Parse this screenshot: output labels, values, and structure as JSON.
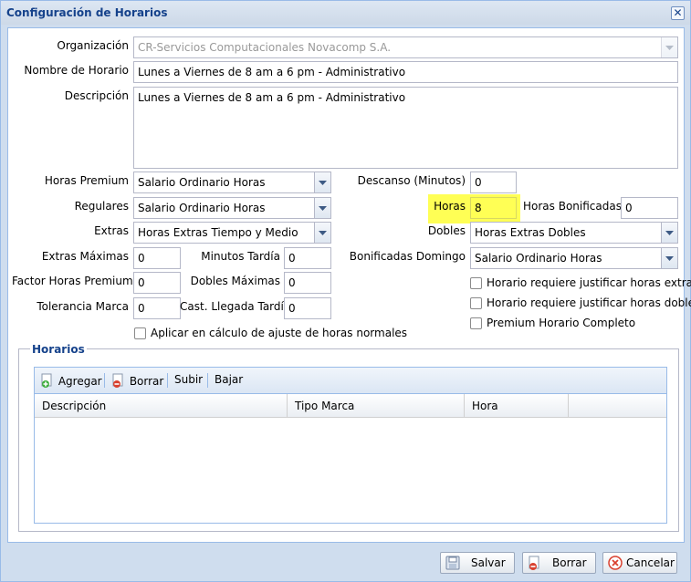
{
  "window": {
    "title": "Configuración de Horarios",
    "close_glyph": "✕"
  },
  "form": {
    "organizacion": {
      "label": "Organización",
      "value": "CR-Servicios Computacionales Novacomp S.A."
    },
    "nombre_horario": {
      "label": "Nombre de Horario",
      "value": "Lunes a Viernes de 8 am a 6 pm - Administrativo"
    },
    "descripcion": {
      "label": "Descripción",
      "value": "Lunes a Viernes de 8 am a 6 pm - Administrativo"
    },
    "horas_premium": {
      "label": "Horas Premium",
      "value": "Salario Ordinario Horas"
    },
    "regulares": {
      "label": "Regulares",
      "value": "Salario Ordinario Horas"
    },
    "extras": {
      "label": "Extras",
      "value": "Horas Extras Tiempo y Medio"
    },
    "extras_maximas": {
      "label": "Extras Máximas",
      "value": "0"
    },
    "minutos_tardia": {
      "label": "Minutos Tardía",
      "value": "0"
    },
    "factor_horas_premium": {
      "label": "Factor Horas Premium",
      "value": "0"
    },
    "dobles_maximas": {
      "label": "Dobles Máximas",
      "value": "0"
    },
    "tolerancia_marca": {
      "label": "Tolerancia Marca",
      "value": "0"
    },
    "cast_llegada_tardia": {
      "label": "Cast. Llegada Tardía",
      "value": "0"
    },
    "aplicar_calculo": {
      "label": "Aplicar en cálculo de ajuste de horas normales",
      "checked": false
    },
    "descanso": {
      "label": "Descanso (Minutos)",
      "value": "0"
    },
    "horas": {
      "label": "Horas",
      "value": "8"
    },
    "horas_bonificadas": {
      "label": "Horas Bonificadas",
      "value": "0"
    },
    "dobles": {
      "label": "Dobles",
      "value": "Horas Extras Dobles"
    },
    "bonificadas_domingo": {
      "label": "Bonificadas Domingo",
      "value": "Salario Ordinario Horas"
    },
    "justificar_extras": {
      "label": "Horario requiere justificar horas extras",
      "checked": false
    },
    "justificar_dobles": {
      "label": "Horario requiere justificar horas dobles",
      "checked": false
    },
    "premium_completo": {
      "label": "Premium Horario Completo",
      "checked": false
    }
  },
  "horarios": {
    "legend": "Horarios",
    "toolbar": {
      "agregar": "Agregar",
      "borrar": "Borrar",
      "subir": "Subir",
      "bajar": "Bajar"
    },
    "columns": [
      "Descripción",
      "Tipo Marca",
      "Hora"
    ],
    "rows": []
  },
  "buttons": {
    "salvar": "Salvar",
    "borrar": "Borrar",
    "cancelar": "Cancelar"
  },
  "colors": {
    "title": "#15428b",
    "highlight": "#ffff55",
    "border": "#99bbe8"
  }
}
